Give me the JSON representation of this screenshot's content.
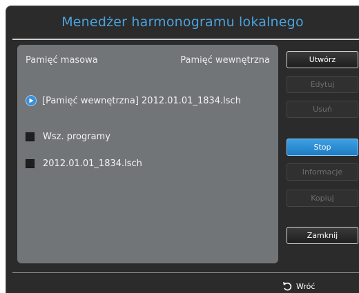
{
  "window": {
    "title": "Menedżer harmonogramu lokalnego"
  },
  "panel": {
    "storage_label": "Pamięć masowa",
    "storage_value": "Pamięć wewnętrzna",
    "current_schedule": "[Pamięć wewnętrzna] 2012.01.01_1834.lsch",
    "items": [
      {
        "label": "Wsz. programy",
        "checked": false
      },
      {
        "label": "2012.01.01_1834.lsch",
        "checked": false
      }
    ]
  },
  "buttons": {
    "create": "Utwórz",
    "edit": "Edytuj",
    "delete": "Usuń",
    "stop": "Stop",
    "info": "Informacje",
    "copy": "Kopiuj",
    "close": "Zamknij"
  },
  "footer": {
    "back_label": "Wróć"
  },
  "colors": {
    "accent": "#3c8fd4",
    "title": "#4aa3df",
    "panel": "#727578",
    "background": "#2b2b2b"
  }
}
